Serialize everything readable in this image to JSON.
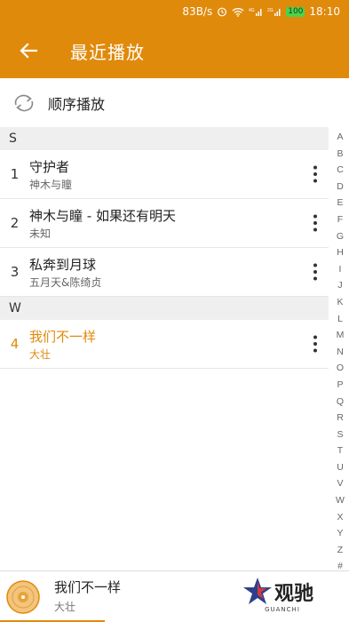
{
  "status_bar": {
    "speed": "83B/s",
    "battery": "100",
    "time": "18:10"
  },
  "toolbar": {
    "title": "最近播放"
  },
  "play_mode": {
    "label": "顺序播放"
  },
  "sections": [
    {
      "letter": "S",
      "songs": [
        {
          "num": "1",
          "name": "守护者",
          "artist": "神木与瞳"
        },
        {
          "num": "2",
          "name": "神木与瞳 - 如果还有明天",
          "artist": "未知"
        },
        {
          "num": "3",
          "name": "私奔到月球",
          "artist": "五月天&陈绮贞"
        }
      ]
    },
    {
      "letter": "W",
      "songs": [
        {
          "num": "4",
          "name": "我们不一样",
          "artist": "大壮"
        }
      ]
    }
  ],
  "index_letters": [
    "A",
    "B",
    "C",
    "D",
    "E",
    "F",
    "G",
    "H",
    "I",
    "J",
    "K",
    "L",
    "M",
    "N",
    "O",
    "P",
    "Q",
    "R",
    "S",
    "T",
    "U",
    "V",
    "W",
    "X",
    "Y",
    "Z",
    "#"
  ],
  "now_playing": {
    "name": "我们不一样",
    "artist": "大壮",
    "progress": 0.3
  },
  "watermark": {
    "text": "观驰",
    "sub": "GUANCHI"
  },
  "colors": {
    "accent": "#e08a0c"
  }
}
